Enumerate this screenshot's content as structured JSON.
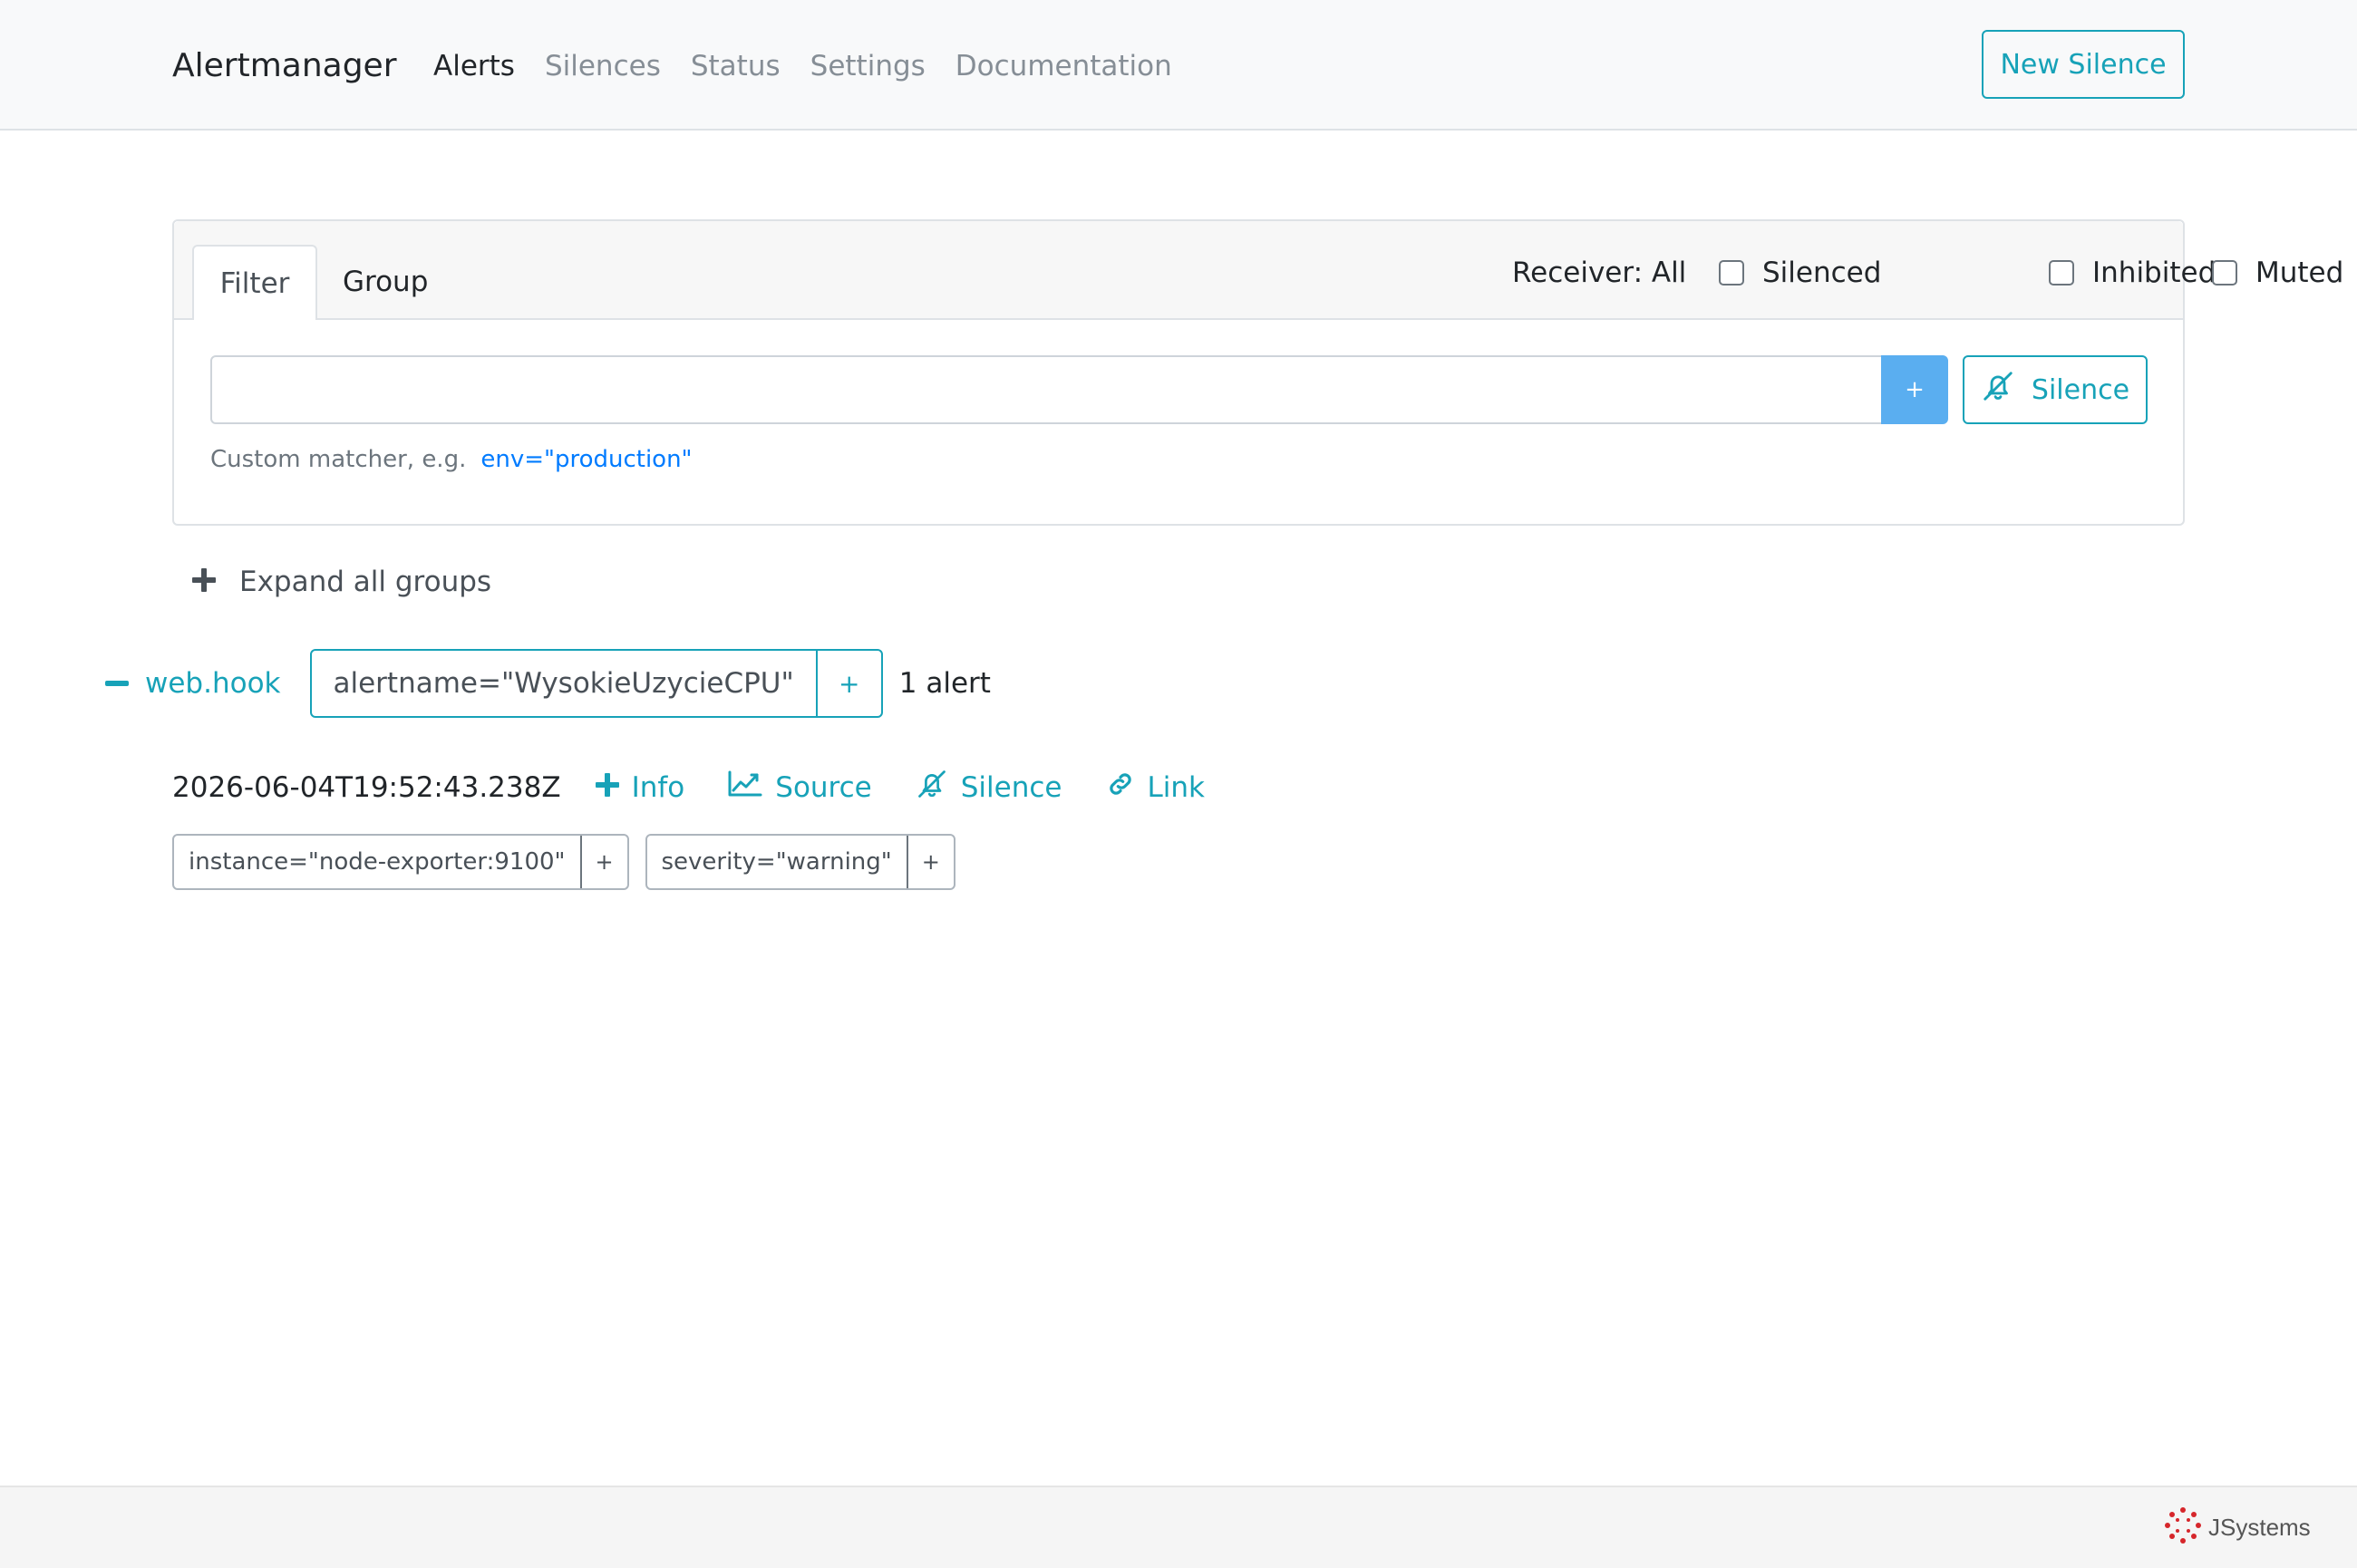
{
  "navbar": {
    "brand": "Alertmanager",
    "links": [
      "Alerts",
      "Silences",
      "Status",
      "Settings",
      "Documentation"
    ],
    "active": "Alerts",
    "new_silence": "New Silence"
  },
  "filter_card": {
    "tabs": [
      "Filter",
      "Group"
    ],
    "receiver_label": "Receiver: All",
    "checkboxes": [
      {
        "label": "Silenced",
        "checked": false
      },
      {
        "label": "Inhibited",
        "checked": false
      },
      {
        "label": "Muted",
        "checked": false
      }
    ],
    "input_value": "",
    "add_button": "+",
    "silence_button": "Silence",
    "hint_text": "Custom matcher, e.g.",
    "hint_example": "env=\"production\""
  },
  "expand_all": "Expand all groups",
  "group": {
    "receiver": "web.hook",
    "matcher": "alertname=\"WysokieUzycieCPU\"",
    "matcher_add": "+",
    "count": "1 alert",
    "alert": {
      "timestamp": "2026-06-04T19:52:43.238Z",
      "actions": {
        "info": "Info",
        "source": "Source",
        "silence": "Silence",
        "link": "Link"
      },
      "labels": [
        {
          "text": "instance=\"node-exporter:9100\"",
          "add": "+"
        },
        {
          "text": "severity=\"warning\"",
          "add": "+"
        }
      ]
    }
  },
  "footer": {
    "logo_text": "JSystems"
  },
  "colors": {
    "accent": "#17a2b8",
    "primary_button": "#5aaef0",
    "link": "#007bff",
    "muted": "#868e96"
  }
}
